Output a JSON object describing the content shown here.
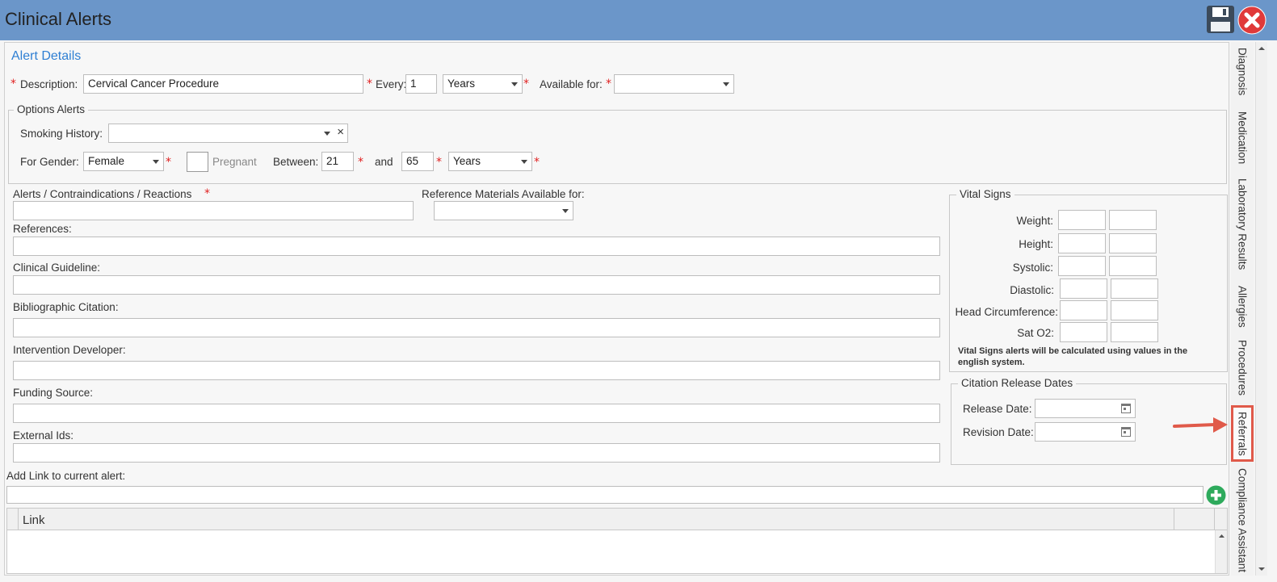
{
  "window": {
    "title": "Clinical Alerts"
  },
  "toolbar": {
    "save_icon": "save-icon",
    "close_icon": "close-icon"
  },
  "alert_details": {
    "title": "Alert Details",
    "description_label": "Description:",
    "description_value": "Cervical Cancer Procedure",
    "every_label": "Every:",
    "every_value": "1",
    "every_unit": "Years",
    "available_for_label": "Available for:",
    "available_for_value": "",
    "required_mark": "*"
  },
  "options_alerts": {
    "title": "Options Alerts",
    "smoking_label": "Smoking History:",
    "smoking_value": "",
    "clear_glyph": "×",
    "gender_label": "For Gender:",
    "gender_value": "Female",
    "pregnant_label": "Pregnant",
    "between_label": "Between:",
    "between_from": "21",
    "and_label": "and",
    "between_to": "65",
    "age_unit": "Years"
  },
  "fields": {
    "alerts_label": "Alerts / Contraindications / Reactions",
    "ref_materials_label": "Reference Materials Available for:",
    "references_label": "References:",
    "guideline_label": "Clinical Guideline:",
    "biblio_label": "Bibliographic Citation:",
    "developer_label": "Intervention Developer:",
    "funding_label": "Funding Source:",
    "external_label": "External Ids:",
    "add_link_label": "Add Link to current alert:"
  },
  "vital_signs": {
    "title": "Vital Signs",
    "rows": [
      "Weight:",
      "Height:",
      "Systolic:",
      "Diastolic:",
      "Head Circumference:",
      "Sat O2:"
    ],
    "note": "Vital Signs alerts will be calculated using values in the english system."
  },
  "citation": {
    "title": "Citation Release Dates",
    "release_label": "Release Date:",
    "revision_label": "Revision Date:"
  },
  "links_table": {
    "column": "Link"
  },
  "side_tabs": [
    "Diagnosis",
    "Medication",
    "Laboratory Results",
    "Allergies",
    "Procedures",
    "Referrals",
    "Compliance Assistant"
  ],
  "highlight_color": "#e05a4a"
}
